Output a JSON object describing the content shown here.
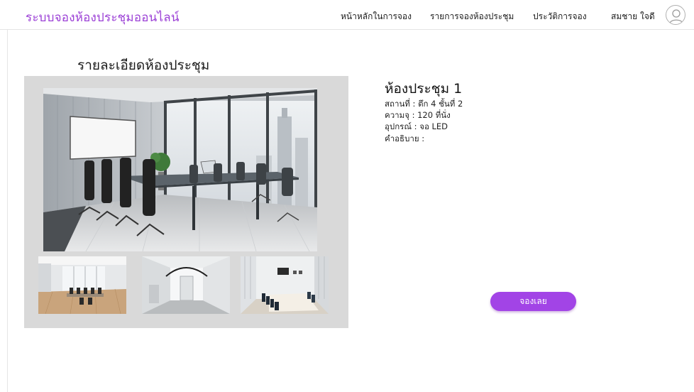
{
  "header": {
    "brand": "ระบบจองห้องประชุมออนไลน์",
    "nav": [
      {
        "label": "หน้าหลักในการจอง"
      },
      {
        "label": "รายการจองห้องประชุม"
      },
      {
        "label": "ประวัติการจอง"
      }
    ],
    "user_name": "สมชาย ใจดี",
    "avatar_icon": "user-avatar-icon"
  },
  "page": {
    "title": "รายละเอียดห้องประชุม"
  },
  "room": {
    "name": "ห้องประชุม 1",
    "location": "สถานที่ : ตึก 4 ชั้นที่ 2",
    "capacity": "ความจุ : 120 ที่นั่ง",
    "equipment": "อุปกรณ์ : จอ LED",
    "description": "คำอธิบาย :"
  },
  "actions": {
    "book_label": "จองเลย"
  },
  "colors": {
    "brand": "#9b3fd6",
    "button": "#a244e6",
    "gallery_bg": "#d9d9d9"
  }
}
